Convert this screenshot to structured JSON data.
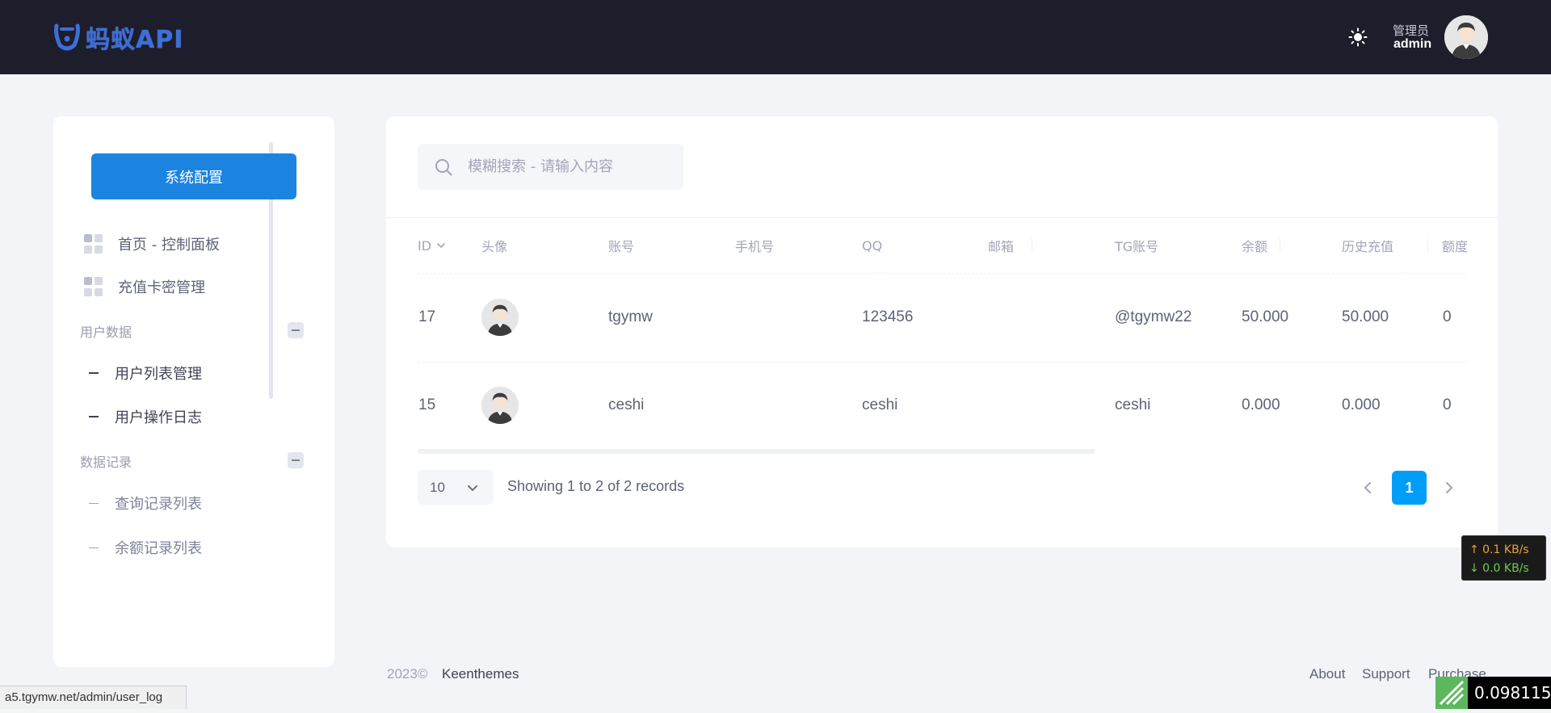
{
  "header": {
    "logo_text": "蚂蚁API",
    "user_role": "管理员",
    "user_name": "admin"
  },
  "sidebar": {
    "config_button": "系统配置",
    "top_items": [
      {
        "label": "首页 - 控制面板",
        "icon": "grid-icon"
      },
      {
        "label": "充值卡密管理",
        "icon": "grid-icon"
      }
    ],
    "sections": [
      {
        "title": "用户数据",
        "items": [
          {
            "label": "用户列表管理"
          },
          {
            "label": "用户操作日志"
          }
        ]
      },
      {
        "title": "数据记录",
        "items": [
          {
            "label": "查询记录列表"
          },
          {
            "label": "余额记录列表"
          }
        ]
      }
    ]
  },
  "search": {
    "placeholder": "模糊搜索 - 请输入内容",
    "value": ""
  },
  "table": {
    "columns": [
      "ID",
      "头像",
      "账号",
      "手机号",
      "QQ",
      "邮箱",
      "TG账号",
      "余额",
      "历史充值",
      "额度"
    ],
    "rows": [
      {
        "id": "17",
        "account": "tgymw",
        "phone": "",
        "qq": "123456",
        "email": "",
        "tg": "@tgymw22",
        "balance": "50.000",
        "history": "50.000",
        "quota": "0"
      },
      {
        "id": "15",
        "account": "ceshi",
        "phone": "",
        "qq": "ceshi",
        "email": "",
        "tg": "ceshi",
        "balance": "0.000",
        "history": "0.000",
        "quota": "0"
      }
    ]
  },
  "pagination": {
    "page_size": "10",
    "records_text": "Showing 1 to 2 of 2 records",
    "current_page": "1"
  },
  "footer": {
    "year": "2023©",
    "brand": "Keenthemes",
    "links": [
      "About",
      "Support",
      "Purchase"
    ]
  },
  "overlays": {
    "net_up": "↑ 0.1 KB/s",
    "net_down": "↓ 0.0 KB/s",
    "status_url": "a5.tgymw.net/admin/user_log",
    "timer": "0.098115s"
  },
  "colors": {
    "header_bg": "#1d1d2c",
    "primary": "#1b84e0",
    "page_active": "#009ef7",
    "page_bg": "#f2f4f7"
  }
}
